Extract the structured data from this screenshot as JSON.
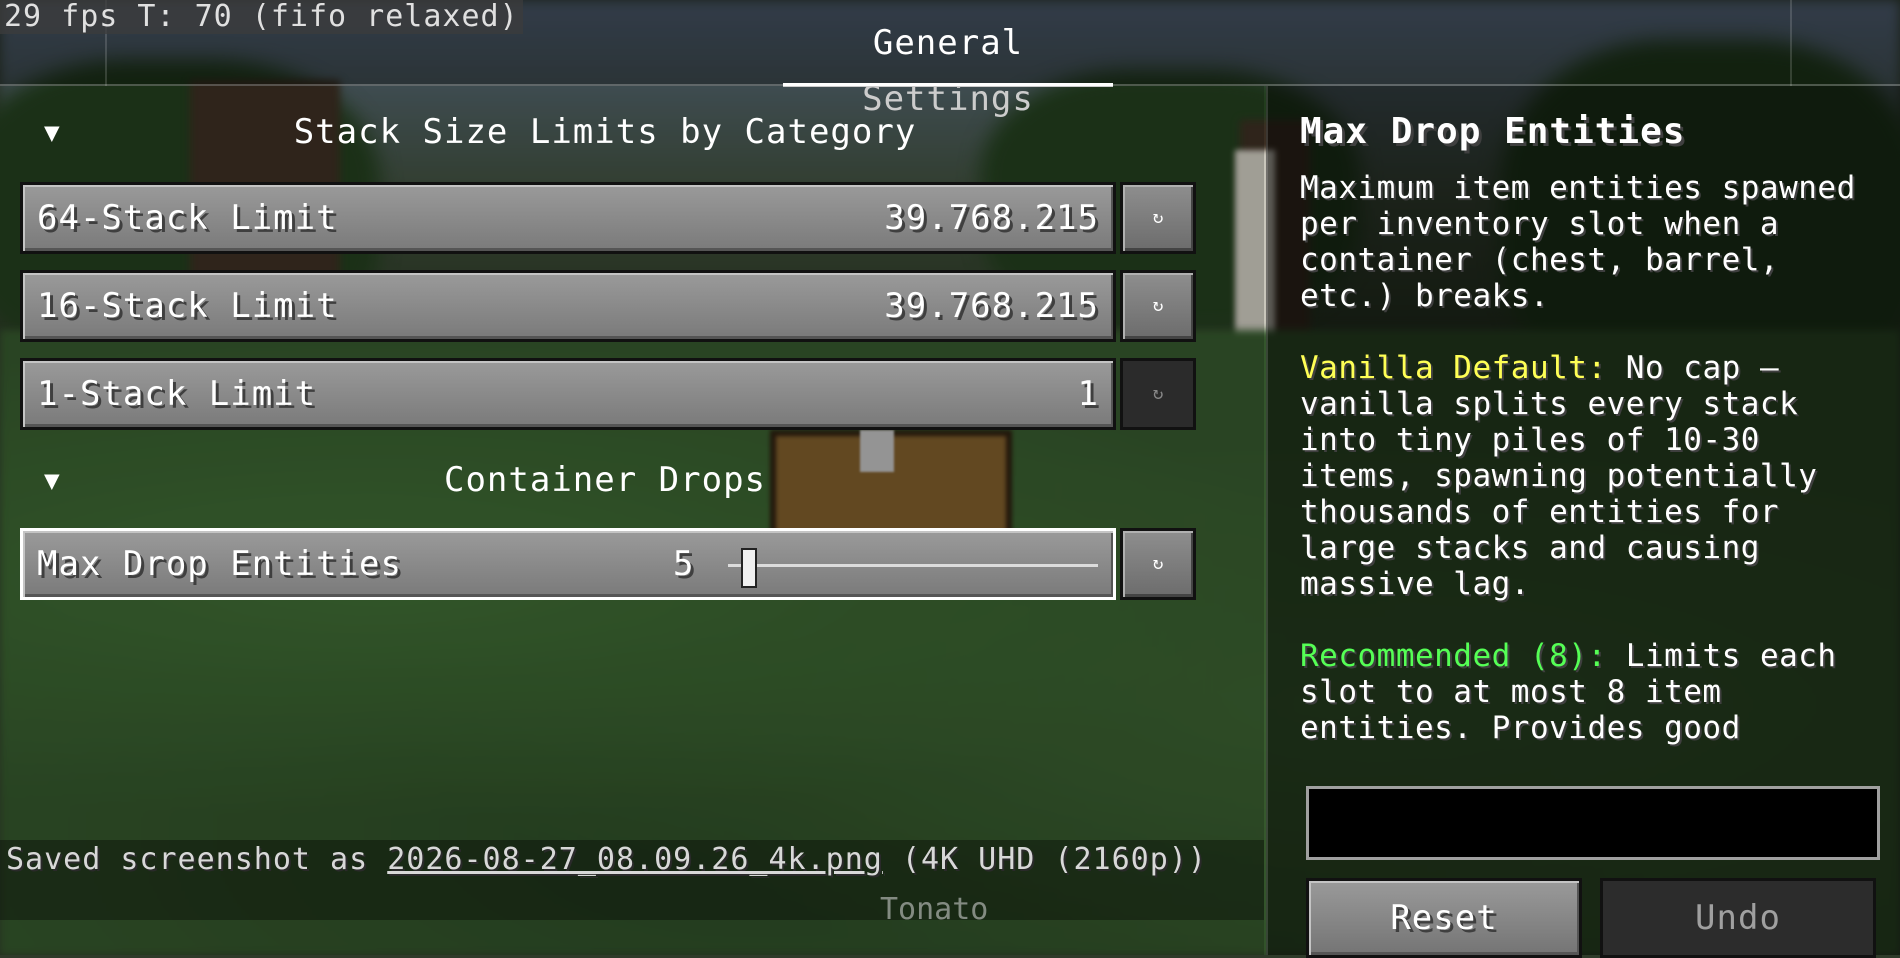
{
  "hud": {
    "fps_text": "29 fps T: 70 (fifo relaxed)"
  },
  "tabs": [
    {
      "label": "General Settings",
      "active": true
    }
  ],
  "sections": [
    {
      "title": "Stack Size Limits by Category",
      "rows": [
        {
          "label": "64-Stack Limit",
          "value": "39.768.215",
          "reset_icon": "↻",
          "reset_enabled": true
        },
        {
          "label": "16-Stack Limit",
          "value": "39.768.215",
          "reset_icon": "↻",
          "reset_enabled": true
        },
        {
          "label": "1-Stack Limit",
          "value": "1",
          "reset_icon": "↻",
          "reset_enabled": false
        }
      ]
    },
    {
      "title": "Container Drops",
      "rows": [
        {
          "label": "Max Drop Entities",
          "value": "5",
          "reset_icon": "↻",
          "reset_enabled": true,
          "slider_fraction": 0.05
        }
      ]
    }
  ],
  "chat": {
    "prefix": "Saved screenshot as",
    "filename": "2026-08-27_08.09.26_4k.png",
    "suffix": "(4K UHD (2160p))",
    "overlay": "Tonato"
  },
  "description": {
    "title": "Max Drop Entities",
    "body": "Maximum item entities spawned per inventory slot when a container (chest, barrel, etc.) breaks.",
    "vanilla_label": "Vanilla Default:",
    "vanilla_text": "No cap — vanilla splits every stack into tiny piles of 10-30 items, spawning potentially thousands of entities for large stacks and causing massive lag.",
    "recommended_label": "Recommended (8):",
    "recommended_text": "Limits each slot to at most 8 item entities. Provides good"
  },
  "buttons": {
    "reset": "Reset",
    "undo": "Undo"
  },
  "colors": {
    "vanilla_label": "#ffff55",
    "recommended_label": "#55ff55"
  }
}
